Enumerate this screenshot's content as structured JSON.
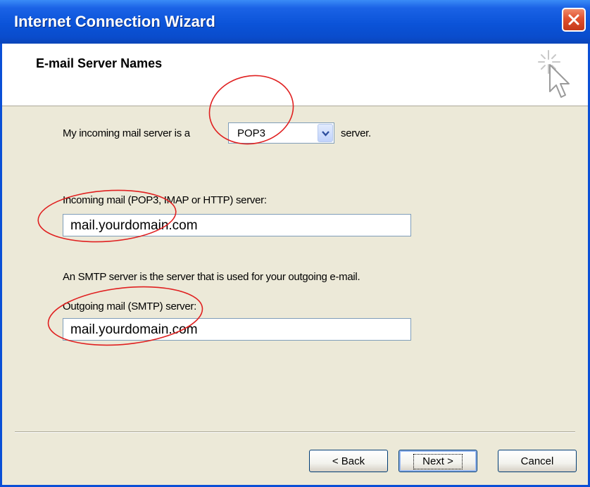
{
  "window": {
    "title": "Internet Connection Wizard",
    "close_icon": "close-icon"
  },
  "header": {
    "title": "E-mail Server Names",
    "icon": "wizard-cursor-icon"
  },
  "incoming_type": {
    "prefix": "My incoming mail server is a",
    "selected": "POP3",
    "suffix": "server."
  },
  "incoming": {
    "label": "Incoming mail (POP3, IMAP or HTTP) server:",
    "value": "mail.yourdomain.com"
  },
  "smtp_note": "An SMTP server is the server that is used for your outgoing e-mail.",
  "outgoing": {
    "label": "Outgoing mail (SMTP) server:",
    "value": "mail.yourdomain.com"
  },
  "buttons": {
    "back": "< Back",
    "next": "Next >",
    "cancel": "Cancel"
  },
  "colors": {
    "titlebar": "#0a4fd6",
    "annotation": "#e02020",
    "dialog_bg": "#ece9d8"
  }
}
